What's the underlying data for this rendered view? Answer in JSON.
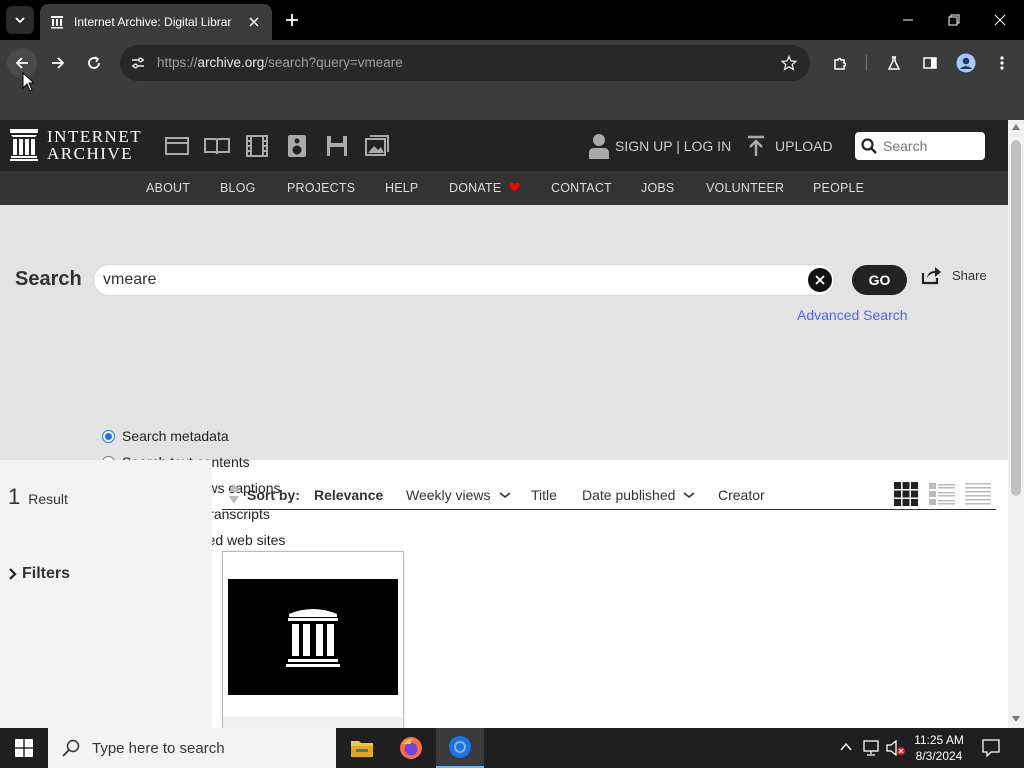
{
  "browser": {
    "tab_title": "Internet Archive: Digital Librar",
    "url_prefix": "https://",
    "url_host": "archive.org",
    "url_path": "/search?query=vmeare"
  },
  "ia_header": {
    "logo_line1": "INTERNET",
    "logo_line2": "ARCHIVE",
    "signup_label": "SIGN UP | LOG IN",
    "upload_label": "UPLOAD",
    "search_placeholder": "Search"
  },
  "nav": {
    "items": [
      "ABOUT",
      "BLOG",
      "PROJECTS",
      "HELP",
      "DONATE",
      "CONTACT",
      "JOBS",
      "VOLUNTEER",
      "PEOPLE"
    ]
  },
  "search": {
    "label": "Search",
    "query": "vmeare",
    "go_label": "GO",
    "share_label": "Share",
    "advanced_label": "Advanced Search",
    "options": [
      {
        "label": "Search metadata",
        "checked": true
      },
      {
        "label": "Search text contents",
        "checked": false
      },
      {
        "label": "Search TV news captions",
        "checked": false
      },
      {
        "label": "Search radio transcripts",
        "checked": false
      },
      {
        "label": "Search archived web sites",
        "checked": false
      }
    ]
  },
  "results": {
    "count": "1",
    "count_label": "Result",
    "filters_label": "Filters"
  },
  "sort": {
    "label": "Sort by:",
    "relevance": "Relevance",
    "weekly_views": "Weekly views",
    "title": "Title",
    "date_published": "Date published",
    "creator": "Creator"
  },
  "taskbar": {
    "search_placeholder": "Type here to search",
    "time": "11:25 AM",
    "date": "8/3/2024"
  },
  "colors": {
    "ia_dark": "#232323",
    "nav_bar": "#333333",
    "search_panel": "#e3e3e3",
    "link_blue": "#4b64ff",
    "donate_heart": "#ff0000"
  }
}
